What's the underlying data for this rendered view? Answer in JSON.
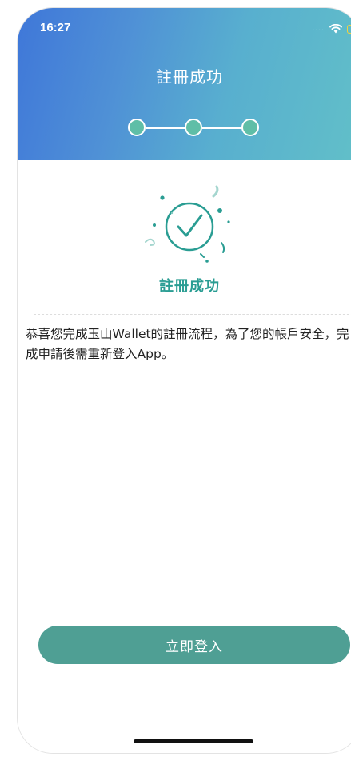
{
  "status_bar": {
    "time": "16:27",
    "signal_dots": "....",
    "wifi_icon": "wifi-icon",
    "battery_icon": "battery-icon"
  },
  "header": {
    "title": "註冊成功",
    "steps_total": 3,
    "steps_completed": 3
  },
  "success": {
    "icon": "check-circle-icon",
    "title": "註冊成功"
  },
  "message": "恭喜您完成玉山Wallet的註冊流程，為了您的帳戶安全，完成申請後需重新登入App。",
  "cta": {
    "label": "立即登入"
  },
  "colors": {
    "gradient_start": "#3f77d9",
    "gradient_end": "#62c0c8",
    "accent": "#2a9d93",
    "button": "#4f9f94"
  }
}
